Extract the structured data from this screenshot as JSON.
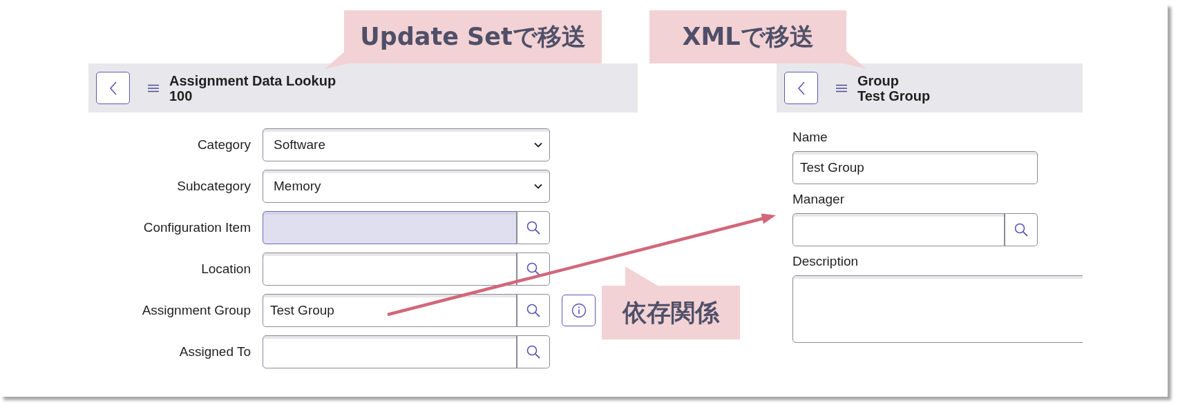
{
  "left_panel": {
    "callout": "Update Setで移送",
    "header": {
      "title": "Assignment Data Lookup",
      "subtitle": "100"
    },
    "fields": [
      {
        "label": "Category",
        "kind": "select",
        "value": "Software"
      },
      {
        "label": "Subcategory",
        "kind": "select",
        "value": "Memory"
      },
      {
        "label": "Configuration Item",
        "kind": "lookup",
        "highlighted": true
      },
      {
        "label": "Location",
        "kind": "lookup",
        "highlighted": false
      },
      {
        "label": "Assignment Group",
        "kind": "lookup",
        "value": "Test Group",
        "highlighted": false,
        "info_button": true
      },
      {
        "label": "Assigned To",
        "kind": "lookup",
        "highlighted": false
      }
    ]
  },
  "dependency_note": "依存関係",
  "right_panel": {
    "callout": "XMLで移送",
    "header": {
      "title": "Group",
      "subtitle": "Test Group"
    },
    "fields": [
      {
        "label": "Name",
        "kind": "text",
        "value": "Test Group"
      },
      {
        "label": "Manager",
        "kind": "lookup"
      },
      {
        "label": "Description",
        "kind": "textarea"
      }
    ]
  }
}
